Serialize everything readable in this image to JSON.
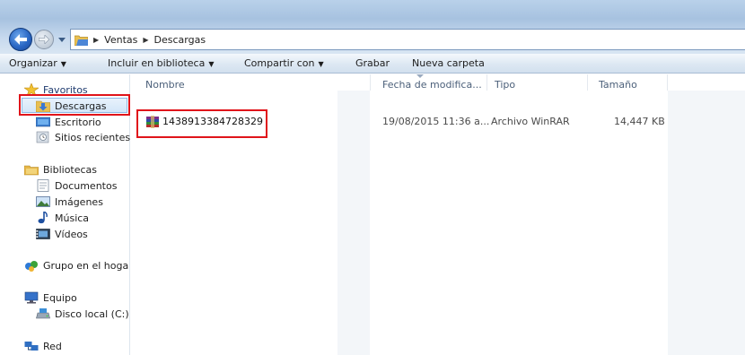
{
  "address": {
    "crumbs": [
      "Ventas",
      "Descargas"
    ]
  },
  "toolbar": {
    "organize": "Organizar",
    "include": "Incluir en biblioteca",
    "share": "Compartir con",
    "burn": "Grabar",
    "new_folder": "Nueva carpeta"
  },
  "sidebar": {
    "favorites": "Favoritos",
    "downloads": "Descargas",
    "desktop": "Escritorio",
    "recent": "Sitios recientes",
    "libraries": "Bibliotecas",
    "documents": "Documentos",
    "pictures": "Imágenes",
    "music": "Música",
    "videos": "Vídeos",
    "homegroup": "Grupo en el hoga",
    "computer": "Equipo",
    "local_disk": "Disco local (C:)",
    "network": "Red"
  },
  "columns": {
    "name": "Nombre",
    "date": "Fecha de modifica...",
    "type": "Tipo",
    "size": "Tamaño"
  },
  "files": [
    {
      "name": "1438913384728329",
      "date": "19/08/2015 11:36 a...",
      "type": "Archivo WinRAR",
      "size": "14,447 KB",
      "icon": "winrar-archive-icon"
    }
  ],
  "colors": {
    "highlight": "#e0141a",
    "selection": "#cfe3f8"
  }
}
